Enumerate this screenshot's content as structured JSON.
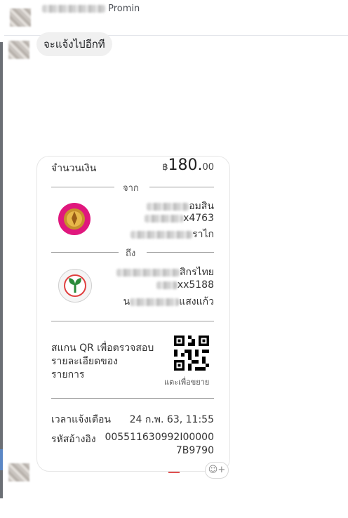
{
  "header": {
    "sender_name_visible": "Promin"
  },
  "message": {
    "text": "จะแจ้งไปอีกที"
  },
  "slip": {
    "amount_label": "จำนวนเงิน",
    "amount_currency": "฿",
    "amount_main": "180.",
    "amount_decimal": "00",
    "from_label": "จาก",
    "from_bank_visible": "อมสิน",
    "from_account_visible": "x4763",
    "from_name_visible": "ราไก",
    "to_label": "ถึง",
    "to_bank_visible": "สิกรไทย",
    "to_account_visible": "xx5188",
    "to_name_prefix": "น",
    "to_name_visible": "แสงแก้ว",
    "qr_text_line1": "สแกน QR เพื่อตรวจสอบ",
    "qr_text_line2": "รายละเอียดของ",
    "qr_text_line3": "รายการ",
    "qr_tap_label": "แตะเพื่อขยาย",
    "time_label": "เวลาแจ้งเตือน",
    "time_value": "24 ก.พ. 63, 11:55",
    "ref_label": "รหัสอ้างอิง",
    "ref_value_line1": "005511630992I00000",
    "ref_value_line2": "7B9790"
  },
  "reaction": {
    "icon": "emoji-add-icon",
    "label": "☺+"
  },
  "colors": {
    "gsb_pink": "#e0177d",
    "kbank_green": "#2a8a3a",
    "bubble": "#f0f0f0"
  }
}
